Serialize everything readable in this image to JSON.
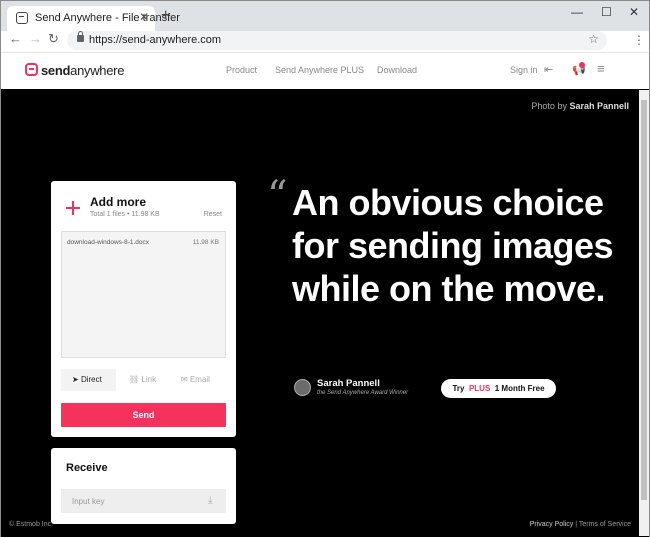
{
  "browser": {
    "tab_title": "Send Anywhere - File transfer",
    "tab_close": "✕",
    "new_tab": "+",
    "url": "https://send-anywhere.com",
    "window_controls": [
      "—",
      "☐",
      "✕"
    ]
  },
  "site": {
    "logo_bold": "send",
    "logo_rest": "anywhere",
    "nav": [
      "Product",
      "Send Anywhere PLUS",
      "Download"
    ],
    "sign_in": "Sign in"
  },
  "hero": {
    "photo_by": "Photo by",
    "photographer": "Sarah Pannell",
    "quote_mark": "“",
    "headline": "An obvious choice for sending images while on the move.",
    "author_name": "Sarah Pannell",
    "author_sub": "the Send Anywhere Award Winner",
    "cta_try": "Try",
    "cta_plus": "PLUS",
    "cta_rest": "1 Month Free"
  },
  "send_panel": {
    "title": "Add more",
    "total": "Total 1 files • 11.98 KB",
    "reset": "Reset",
    "files": [
      {
        "name": "download-windows-8-1.docx",
        "size": "11.98 KB"
      }
    ],
    "methods": [
      "Direct",
      "Link",
      "Email"
    ],
    "send_label": "Send"
  },
  "receive_panel": {
    "title": "Receive",
    "placeholder": "Input key"
  },
  "footer": {
    "copyright": "© Estmob Inc.",
    "privacy": "Privacy Policy",
    "separator": "|",
    "terms": "Terms of Service"
  },
  "colors": {
    "accent": "#f5315e"
  }
}
